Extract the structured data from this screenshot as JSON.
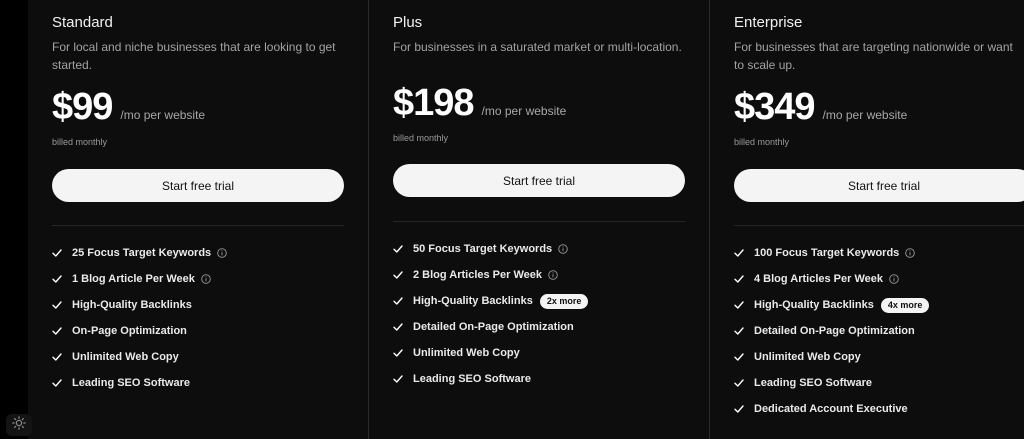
{
  "plans": [
    {
      "name": "Standard",
      "description": "For local and niche businesses that are looking to get started.",
      "price": "$99",
      "per": "/mo per website",
      "billing": "billed monthly",
      "cta_label": "Start free trial",
      "features": [
        {
          "label": "25 Focus Target Keywords",
          "info": true
        },
        {
          "label": "1 Blog Article Per Week",
          "info": true
        },
        {
          "label": "High-Quality Backlinks"
        },
        {
          "label": "On-Page Optimization"
        },
        {
          "label": "Unlimited Web Copy"
        },
        {
          "label": "Leading SEO Software"
        }
      ]
    },
    {
      "name": "Plus",
      "description": "For businesses in a saturated market or multi-location.",
      "price": "$198",
      "per": "/mo per website",
      "billing": "billed monthly",
      "cta_label": "Start free trial",
      "features": [
        {
          "label": "50 Focus Target Keywords",
          "info": true
        },
        {
          "label": "2 Blog Articles Per Week",
          "info": true
        },
        {
          "label": "High-Quality Backlinks",
          "badge": "2x more"
        },
        {
          "label": "Detailed On-Page Optimization"
        },
        {
          "label": "Unlimited Web Copy"
        },
        {
          "label": "Leading SEO Software"
        }
      ]
    },
    {
      "name": "Enterprise",
      "description": "For businesses that are targeting nationwide or want to scale up.",
      "price": "$349",
      "per": "/mo per website",
      "billing": "billed monthly",
      "cta_label": "Start free trial",
      "features": [
        {
          "label": "100 Focus Target Keywords",
          "info": true
        },
        {
          "label": "4 Blog Articles Per Week",
          "info": true
        },
        {
          "label": "High-Quality Backlinks",
          "badge": "4x more"
        },
        {
          "label": "Detailed On-Page Optimization"
        },
        {
          "label": "Unlimited Web Copy"
        },
        {
          "label": "Leading SEO Software"
        },
        {
          "label": "Dedicated Account Executive"
        }
      ]
    }
  ],
  "icons": {
    "check": "check-icon",
    "info": "info-icon",
    "theme_toggle": "sun-icon"
  },
  "colors": {
    "background": "#000000",
    "card": "#0d0d0d",
    "button": "#f4f4f4",
    "muted_text": "#a3a3a3"
  }
}
